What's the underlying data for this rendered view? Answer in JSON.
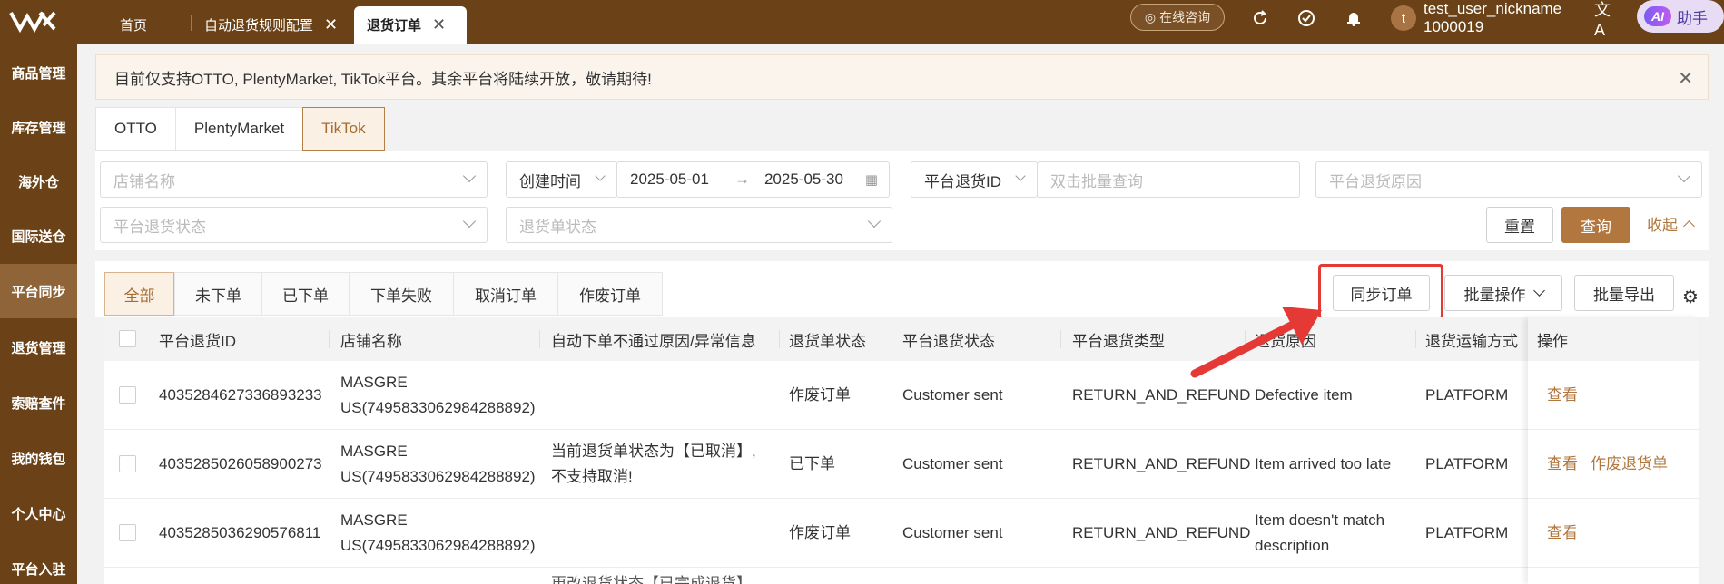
{
  "topbar": {
    "tabs": [
      {
        "label": "首页"
      },
      {
        "label": "自动退货规则配置"
      },
      {
        "label": "退货订单"
      }
    ],
    "consult_label": "在线咨询",
    "avatar_letter": "t",
    "username_line1": "test_user_nickname",
    "username_line2": "1000019",
    "ai_badge": "AI",
    "ai_label": "助手"
  },
  "sidebar": {
    "items": [
      "商品管理",
      "库存管理",
      "海外仓",
      "国际送仓",
      "平台同步",
      "退货管理",
      "索赔查件",
      "我的钱包",
      "个人中心",
      "平台入驻"
    ],
    "active_index": 4
  },
  "notice": {
    "text": "目前仅支持OTTO, PlentyMarket, TikTok平台。其余平台将陆续开放，敬请期待!"
  },
  "platform_tabs": [
    "OTTO",
    "PlentyMarket",
    "TikTok"
  ],
  "filters": {
    "store_placeholder": "店铺名称",
    "date_type": "创建时间",
    "date_start": "2025-05-01",
    "date_sep": "→",
    "date_end": "2025-05-30",
    "id_type": "平台退货ID",
    "id_placeholder": "双击批量查询",
    "reason_placeholder": "平台退货原因",
    "platform_status_placeholder": "平台退货状态",
    "return_status_placeholder": "退货单状态",
    "reset_label": "重置",
    "search_label": "查询",
    "collapse_label": "收起"
  },
  "status_tabs": [
    "全部",
    "未下单",
    "已下单",
    "下单失败",
    "取消订单",
    "作废订单"
  ],
  "toolbar": {
    "sync_label": "同步订单",
    "batch_label": "批量操作",
    "export_label": "批量导出"
  },
  "table": {
    "headers": [
      "平台退货ID",
      "店铺名称",
      "自动下单不通过原因/异常信息",
      "退货单状态",
      "平台退货状态",
      "平台退货类型",
      "退货原因",
      "退货运输方式",
      "操作"
    ],
    "rows": [
      {
        "id": "4035284627336893233",
        "store1": "MASGRE",
        "store2": "US(7495833062984288892)",
        "error1": "",
        "error2": "",
        "return_status": "作废订单",
        "platform_status": "Customer sent",
        "type": "RETURN_AND_REFUND",
        "reason1": "Defective item",
        "reason2": "",
        "shipping": "PLATFORM",
        "op1": "查看",
        "op2": ""
      },
      {
        "id": "4035285026058900273",
        "store1": "MASGRE",
        "store2": "US(7495833062984288892)",
        "error1": "当前退货单状态为【已取消】,",
        "error2": "不支持取消!",
        "return_status": "已下单",
        "platform_status": "Customer sent",
        "type": "RETURN_AND_REFUND",
        "reason1": "Item arrived too late",
        "reason2": "",
        "shipping": "PLATFORM",
        "op1": "查看",
        "op2": "作废退货单"
      },
      {
        "id": "4035285036290576811",
        "store1": "MASGRE",
        "store2": "US(7495833062984288892)",
        "error1": "",
        "error2": "",
        "return_status": "作废订单",
        "platform_status": "Customer sent",
        "type": "RETURN_AND_REFUND",
        "reason1": "Item doesn't match",
        "reason2": "description",
        "shipping": "PLATFORM",
        "op1": "查看",
        "op2": ""
      }
    ],
    "partial_row_text": "更改退货状态【已完成退货】"
  },
  "colors": {
    "brand": "#6b4217",
    "accent": "#b1773e",
    "highlight": "#e53935"
  }
}
